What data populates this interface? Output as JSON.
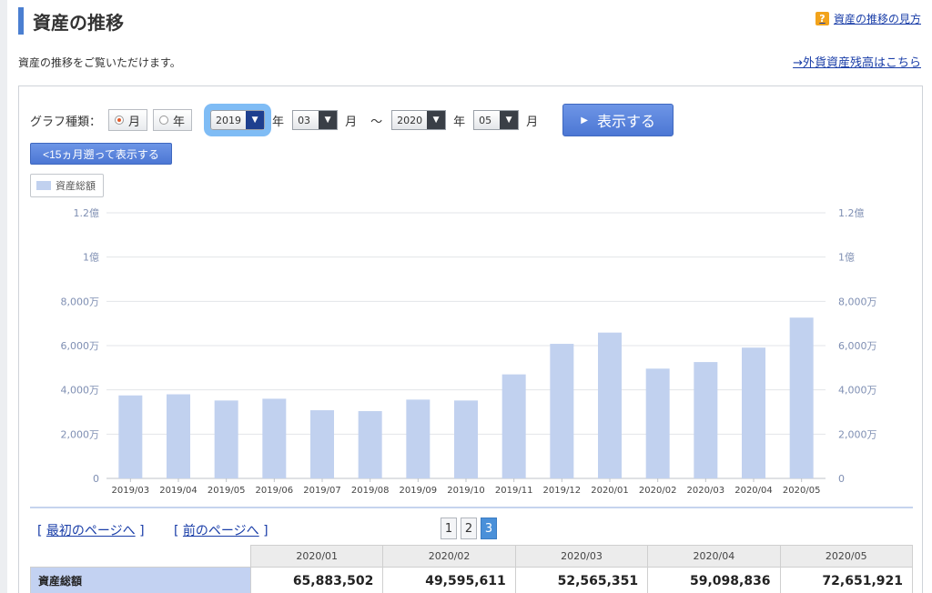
{
  "header": {
    "title": "資産の推移",
    "help_link": "資産の推移の見方",
    "help_icon": "question-icon",
    "description": "資産の推移をご覧いただけます。",
    "foreign_link": "→外貨資産残高はこちら"
  },
  "controls": {
    "graph_type_label": "グラフ種類：",
    "radio_month": "月",
    "radio_year": "年",
    "selected_type": "月",
    "start_year": "2019",
    "start_month": "03",
    "end_year": "2020",
    "end_month": "05",
    "year_unit": "年",
    "month_unit": "月",
    "range_sep": "〜",
    "show_button": "表示する",
    "back_button": "<15ヵ月遡って表示する"
  },
  "legend": {
    "label": "資産総額",
    "color": "#c1d1ef"
  },
  "chart_data": {
    "type": "bar",
    "categories": [
      "2019/03",
      "2019/04",
      "2019/05",
      "2019/06",
      "2019/07",
      "2019/08",
      "2019/09",
      "2019/10",
      "2019/11",
      "2019/12",
      "2020/01",
      "2020/02",
      "2020/03",
      "2020/04",
      "2020/05"
    ],
    "series": [
      {
        "name": "資産総額",
        "values": [
          37500000,
          38000000,
          35200000,
          36000000,
          30800000,
          30400000,
          35600000,
          35200000,
          47000000,
          60800000,
          65883502,
          49595611,
          52565351,
          59098836,
          72651921
        ]
      }
    ],
    "ylim": [
      0,
      120000000
    ],
    "yticks": [
      "0",
      "2,000万",
      "4,000万",
      "6,000万",
      "8,000万",
      "1億",
      "1.2億"
    ],
    "grid": true,
    "bar_color": "#c1d1ef"
  },
  "pagination": {
    "first_label": "最初のページへ",
    "prev_label": "前のページへ",
    "pages": [
      "1",
      "2",
      "3"
    ],
    "active": "3"
  },
  "table": {
    "headers": [
      "2020/01",
      "2020/02",
      "2020/03",
      "2020/04",
      "2020/05"
    ],
    "row_label": "資産総額",
    "values": [
      "65,883,502",
      "49,595,611",
      "52,565,351",
      "59,098,836",
      "72,651,921"
    ]
  }
}
